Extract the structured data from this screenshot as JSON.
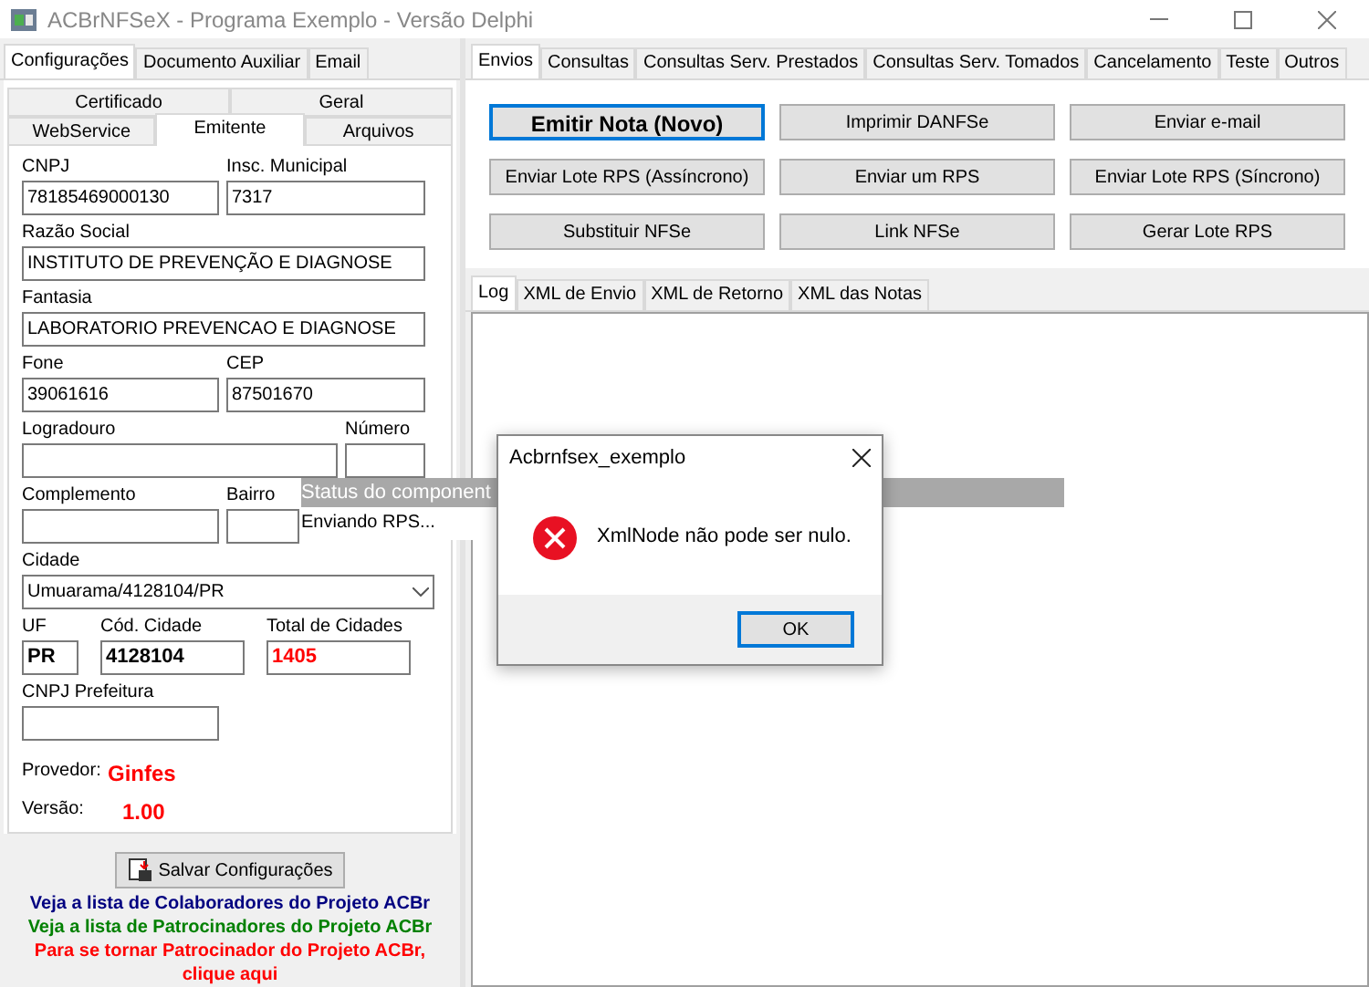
{
  "window": {
    "title": "ACBrNFSeX - Programa Exemplo - Versão Delphi"
  },
  "config_tabs": [
    {
      "label": "Configurações",
      "selected": true
    },
    {
      "label": "Documento Auxiliar",
      "selected": false
    },
    {
      "label": "Email",
      "selected": false
    }
  ],
  "subtab_rows": [
    {
      "tabs": [
        {
          "label": "Certificado",
          "selected": false
        },
        {
          "label": "Geral",
          "selected": false
        }
      ]
    },
    {
      "tabs": [
        {
          "label": "WebService",
          "selected": false
        },
        {
          "label": "Emitente",
          "selected": true
        },
        {
          "label": "Arquivos",
          "selected": false
        }
      ]
    }
  ],
  "form": {
    "cnpj": {
      "label": "CNPJ",
      "value": "78185469000130"
    },
    "insc_municipal": {
      "label": "Insc. Municipal",
      "value": "7317"
    },
    "razao_social": {
      "label": "Razão Social",
      "value": "INSTITUTO DE PREVENÇÃO E DIAGNOSE"
    },
    "fantasia": {
      "label": "Fantasia",
      "value": "LABORATORIO PREVENCAO E DIAGNOSE"
    },
    "fone": {
      "label": "Fone",
      "value": "39061616"
    },
    "cep": {
      "label": "CEP",
      "value": "87501670"
    },
    "logradouro": {
      "label": "Logradouro"
    },
    "numero": {
      "label": "Número"
    },
    "complemento": {
      "label": "Complemento"
    },
    "bairro": {
      "label": "Bairro"
    },
    "cidade": {
      "label": "Cidade",
      "value": "Umuarama/4128104/PR"
    },
    "uf": {
      "label": "UF",
      "value": "PR"
    },
    "cod_cidade": {
      "label": "Cód. Cidade",
      "value": "4128104"
    },
    "total_cidades": {
      "label": "Total de Cidades",
      "value": "1405"
    },
    "cnpj_prefeitura": {
      "label": "CNPJ Prefeitura"
    }
  },
  "provedor": {
    "label": "Provedor:",
    "value": "Ginfes"
  },
  "versao": {
    "label": "Versão:",
    "value": "1.00"
  },
  "save_button": {
    "label": "Salvar Configurações"
  },
  "links": [
    {
      "text": "Veja a lista de Colaboradores do Projeto ACBr",
      "color": "#000080"
    },
    {
      "text": "Veja a lista de Patrocinadores do Projeto ACBr",
      "color": "#008000"
    },
    {
      "text": "Para se tornar Patrocinador do Projeto ACBr,",
      "color": "#ff0000"
    },
    {
      "text": "clique aqui",
      "color": "#ff0000"
    }
  ],
  "action_tabs": [
    {
      "label": "Envios",
      "selected": true
    },
    {
      "label": "Consultas",
      "selected": false
    },
    {
      "label": "Consultas Serv. Prestados",
      "selected": false
    },
    {
      "label": "Consultas Serv. Tomados",
      "selected": false
    },
    {
      "label": "Cancelamento",
      "selected": false
    },
    {
      "label": "Teste",
      "selected": false
    },
    {
      "label": "Outros",
      "selected": false
    }
  ],
  "action_buttons": [
    {
      "label": "Emitir Nota (Novo)",
      "default": true
    },
    {
      "label": "Imprimir DANFSe",
      "default": false
    },
    {
      "label": "Enviar e-mail",
      "default": false
    },
    {
      "label": "Enviar Lote RPS (Assíncrono)",
      "default": false
    },
    {
      "label": "Enviar um RPS",
      "default": false
    },
    {
      "label": "Enviar Lote RPS (Síncrono)",
      "default": false
    },
    {
      "label": "Substituir NFSe",
      "default": false
    },
    {
      "label": "Link NFSe",
      "default": false
    },
    {
      "label": "Gerar Lote RPS",
      "default": false
    }
  ],
  "log_tabs": [
    {
      "label": "Log",
      "selected": true
    },
    {
      "label": "XML de Envio",
      "selected": false
    },
    {
      "label": "XML de Retorno",
      "selected": false
    },
    {
      "label": "XML das Notas",
      "selected": false
    }
  ],
  "status_popup": {
    "title": "Status do component",
    "message": "Enviando RPS..."
  },
  "dialog": {
    "title": "Acbrnfsex_exemplo",
    "message": "XmlNode não pode ser nulo.",
    "button": "OK"
  }
}
